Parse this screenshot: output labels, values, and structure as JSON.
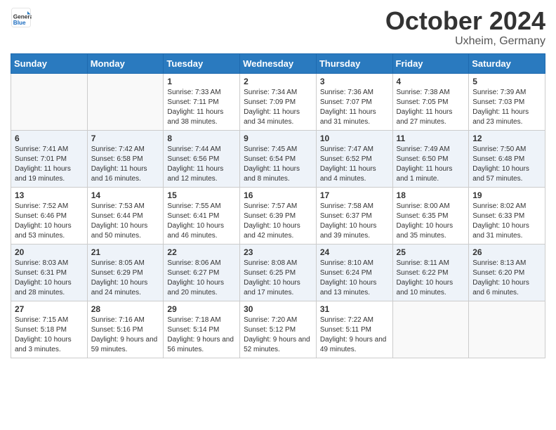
{
  "logo": {
    "general": "General",
    "blue": "Blue"
  },
  "header": {
    "month": "October 2024",
    "location": "Uxheim, Germany"
  },
  "weekdays": [
    "Sunday",
    "Monday",
    "Tuesday",
    "Wednesday",
    "Thursday",
    "Friday",
    "Saturday"
  ],
  "weeks": [
    [
      {
        "day": "",
        "sunrise": "",
        "sunset": "",
        "daylight": ""
      },
      {
        "day": "",
        "sunrise": "",
        "sunset": "",
        "daylight": ""
      },
      {
        "day": "1",
        "sunrise": "Sunrise: 7:33 AM",
        "sunset": "Sunset: 7:11 PM",
        "daylight": "Daylight: 11 hours and 38 minutes."
      },
      {
        "day": "2",
        "sunrise": "Sunrise: 7:34 AM",
        "sunset": "Sunset: 7:09 PM",
        "daylight": "Daylight: 11 hours and 34 minutes."
      },
      {
        "day": "3",
        "sunrise": "Sunrise: 7:36 AM",
        "sunset": "Sunset: 7:07 PM",
        "daylight": "Daylight: 11 hours and 31 minutes."
      },
      {
        "day": "4",
        "sunrise": "Sunrise: 7:38 AM",
        "sunset": "Sunset: 7:05 PM",
        "daylight": "Daylight: 11 hours and 27 minutes."
      },
      {
        "day": "5",
        "sunrise": "Sunrise: 7:39 AM",
        "sunset": "Sunset: 7:03 PM",
        "daylight": "Daylight: 11 hours and 23 minutes."
      }
    ],
    [
      {
        "day": "6",
        "sunrise": "Sunrise: 7:41 AM",
        "sunset": "Sunset: 7:01 PM",
        "daylight": "Daylight: 11 hours and 19 minutes."
      },
      {
        "day": "7",
        "sunrise": "Sunrise: 7:42 AM",
        "sunset": "Sunset: 6:58 PM",
        "daylight": "Daylight: 11 hours and 16 minutes."
      },
      {
        "day": "8",
        "sunrise": "Sunrise: 7:44 AM",
        "sunset": "Sunset: 6:56 PM",
        "daylight": "Daylight: 11 hours and 12 minutes."
      },
      {
        "day": "9",
        "sunrise": "Sunrise: 7:45 AM",
        "sunset": "Sunset: 6:54 PM",
        "daylight": "Daylight: 11 hours and 8 minutes."
      },
      {
        "day": "10",
        "sunrise": "Sunrise: 7:47 AM",
        "sunset": "Sunset: 6:52 PM",
        "daylight": "Daylight: 11 hours and 4 minutes."
      },
      {
        "day": "11",
        "sunrise": "Sunrise: 7:49 AM",
        "sunset": "Sunset: 6:50 PM",
        "daylight": "Daylight: 11 hours and 1 minute."
      },
      {
        "day": "12",
        "sunrise": "Sunrise: 7:50 AM",
        "sunset": "Sunset: 6:48 PM",
        "daylight": "Daylight: 10 hours and 57 minutes."
      }
    ],
    [
      {
        "day": "13",
        "sunrise": "Sunrise: 7:52 AM",
        "sunset": "Sunset: 6:46 PM",
        "daylight": "Daylight: 10 hours and 53 minutes."
      },
      {
        "day": "14",
        "sunrise": "Sunrise: 7:53 AM",
        "sunset": "Sunset: 6:44 PM",
        "daylight": "Daylight: 10 hours and 50 minutes."
      },
      {
        "day": "15",
        "sunrise": "Sunrise: 7:55 AM",
        "sunset": "Sunset: 6:41 PM",
        "daylight": "Daylight: 10 hours and 46 minutes."
      },
      {
        "day": "16",
        "sunrise": "Sunrise: 7:57 AM",
        "sunset": "Sunset: 6:39 PM",
        "daylight": "Daylight: 10 hours and 42 minutes."
      },
      {
        "day": "17",
        "sunrise": "Sunrise: 7:58 AM",
        "sunset": "Sunset: 6:37 PM",
        "daylight": "Daylight: 10 hours and 39 minutes."
      },
      {
        "day": "18",
        "sunrise": "Sunrise: 8:00 AM",
        "sunset": "Sunset: 6:35 PM",
        "daylight": "Daylight: 10 hours and 35 minutes."
      },
      {
        "day": "19",
        "sunrise": "Sunrise: 8:02 AM",
        "sunset": "Sunset: 6:33 PM",
        "daylight": "Daylight: 10 hours and 31 minutes."
      }
    ],
    [
      {
        "day": "20",
        "sunrise": "Sunrise: 8:03 AM",
        "sunset": "Sunset: 6:31 PM",
        "daylight": "Daylight: 10 hours and 28 minutes."
      },
      {
        "day": "21",
        "sunrise": "Sunrise: 8:05 AM",
        "sunset": "Sunset: 6:29 PM",
        "daylight": "Daylight: 10 hours and 24 minutes."
      },
      {
        "day": "22",
        "sunrise": "Sunrise: 8:06 AM",
        "sunset": "Sunset: 6:27 PM",
        "daylight": "Daylight: 10 hours and 20 minutes."
      },
      {
        "day": "23",
        "sunrise": "Sunrise: 8:08 AM",
        "sunset": "Sunset: 6:25 PM",
        "daylight": "Daylight: 10 hours and 17 minutes."
      },
      {
        "day": "24",
        "sunrise": "Sunrise: 8:10 AM",
        "sunset": "Sunset: 6:24 PM",
        "daylight": "Daylight: 10 hours and 13 minutes."
      },
      {
        "day": "25",
        "sunrise": "Sunrise: 8:11 AM",
        "sunset": "Sunset: 6:22 PM",
        "daylight": "Daylight: 10 hours and 10 minutes."
      },
      {
        "day": "26",
        "sunrise": "Sunrise: 8:13 AM",
        "sunset": "Sunset: 6:20 PM",
        "daylight": "Daylight: 10 hours and 6 minutes."
      }
    ],
    [
      {
        "day": "27",
        "sunrise": "Sunrise: 7:15 AM",
        "sunset": "Sunset: 5:18 PM",
        "daylight": "Daylight: 10 hours and 3 minutes."
      },
      {
        "day": "28",
        "sunrise": "Sunrise: 7:16 AM",
        "sunset": "Sunset: 5:16 PM",
        "daylight": "Daylight: 9 hours and 59 minutes."
      },
      {
        "day": "29",
        "sunrise": "Sunrise: 7:18 AM",
        "sunset": "Sunset: 5:14 PM",
        "daylight": "Daylight: 9 hours and 56 minutes."
      },
      {
        "day": "30",
        "sunrise": "Sunrise: 7:20 AM",
        "sunset": "Sunset: 5:12 PM",
        "daylight": "Daylight: 9 hours and 52 minutes."
      },
      {
        "day": "31",
        "sunrise": "Sunrise: 7:22 AM",
        "sunset": "Sunset: 5:11 PM",
        "daylight": "Daylight: 9 hours and 49 minutes."
      },
      {
        "day": "",
        "sunrise": "",
        "sunset": "",
        "daylight": ""
      },
      {
        "day": "",
        "sunrise": "",
        "sunset": "",
        "daylight": ""
      }
    ]
  ]
}
